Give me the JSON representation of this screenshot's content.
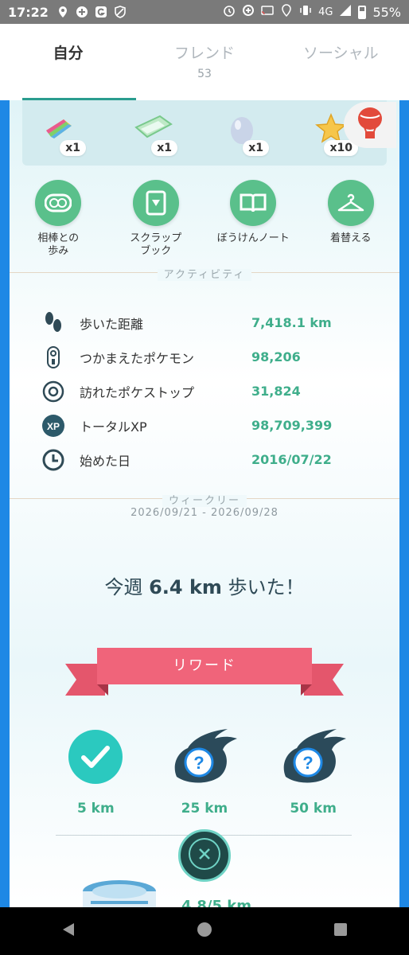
{
  "status_bar": {
    "time": "17:22",
    "network": "4G",
    "battery": "55%"
  },
  "tabs": [
    {
      "label": "自分",
      "count": ""
    },
    {
      "label": "フレンド",
      "count": "53"
    },
    {
      "label": "ソーシャル",
      "count": ""
    }
  ],
  "items": [
    {
      "icon": "rainbow-candy-icon",
      "qty": "x1"
    },
    {
      "icon": "blue-ticket-icon",
      "qty": "x1"
    },
    {
      "icon": "egg-icon",
      "qty": "x1"
    },
    {
      "icon": "stardust-star-icon",
      "qty": "x10"
    }
  ],
  "shop_icon": "balloon-icon",
  "actions": [
    {
      "label": "相棒との\n歩み",
      "icon": "buddy-icon"
    },
    {
      "label": "スクラップ\nブック",
      "icon": "scrapbook-icon"
    },
    {
      "label": "ぼうけんノート",
      "icon": "journal-icon"
    },
    {
      "label": "着替える",
      "icon": "hanger-icon"
    }
  ],
  "activity": {
    "header": "アクティビティ",
    "rows": [
      {
        "icon": "footsteps-icon",
        "label": "歩いた距離",
        "value": "7,418.1 km"
      },
      {
        "icon": "pokedex-icon",
        "label": "つかまえたポケモン",
        "value": "98,206"
      },
      {
        "icon": "pokestop-icon",
        "label": "訪れたポケストップ",
        "value": "31,824"
      },
      {
        "icon": "xp-icon",
        "label": "トータルXP",
        "value": "98,709,399"
      },
      {
        "icon": "clock-icon",
        "label": "始めた日",
        "value": "2016/07/22"
      }
    ]
  },
  "weekly": {
    "header": "ウィークリー",
    "range": "2026/09/21 - 2026/09/28",
    "title_prefix": "今週 ",
    "distance": "6.4 km",
    "title_suffix": " 歩いた！",
    "reward_label": "リワード",
    "rewards": [
      {
        "label": "5 km",
        "state": "completed"
      },
      {
        "label": "25 km",
        "state": "locked"
      },
      {
        "label": "50 km",
        "state": "locked"
      }
    ],
    "partial_text": "4.8/5 km"
  },
  "colors": {
    "accent_green": "#3fae8b",
    "action_green": "#5ac08b",
    "border_blue": "#1e88e5",
    "ribbon_pink": "#f0647a",
    "completed_teal": "#2bc9bf"
  }
}
